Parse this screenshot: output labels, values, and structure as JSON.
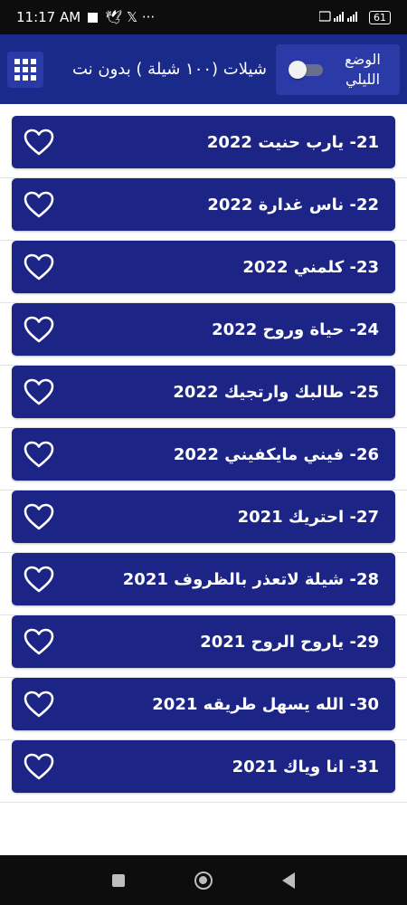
{
  "status_bar": {
    "time": "11:17 AM",
    "notification_glyphs": "🕊 𝕏  ···",
    "battery": "61"
  },
  "app_bar": {
    "title": "شيلات (١٠٠ شيلة ) بدون نت",
    "night_mode_label": "الوضع الليلي",
    "night_mode_on": false
  },
  "items": [
    {
      "title": "21- يارب حنيت 2022"
    },
    {
      "title": "22- ناس غدارة 2022"
    },
    {
      "title": "23- كلمني 2022"
    },
    {
      "title": "24- حياة وروح 2022"
    },
    {
      "title": "25- طالبك وارتجيك 2022"
    },
    {
      "title": "26- فيني مايكفيني 2022"
    },
    {
      "title": "27- احتريك 2021"
    },
    {
      "title": "28- شيلة لاتعذر بالظروف 2021"
    },
    {
      "title": "29- ياروح الروح 2021"
    },
    {
      "title": "30- الله يسهل طريقه 2021"
    },
    {
      "title": "31- انا وياك 2021"
    }
  ],
  "colors": {
    "app_bar": "#1a2a8a",
    "card": "#1c2586",
    "accent_box": "#2a3ba8"
  },
  "icons": {
    "menu": "grid-icon",
    "favorite": "heart-outline-icon"
  }
}
